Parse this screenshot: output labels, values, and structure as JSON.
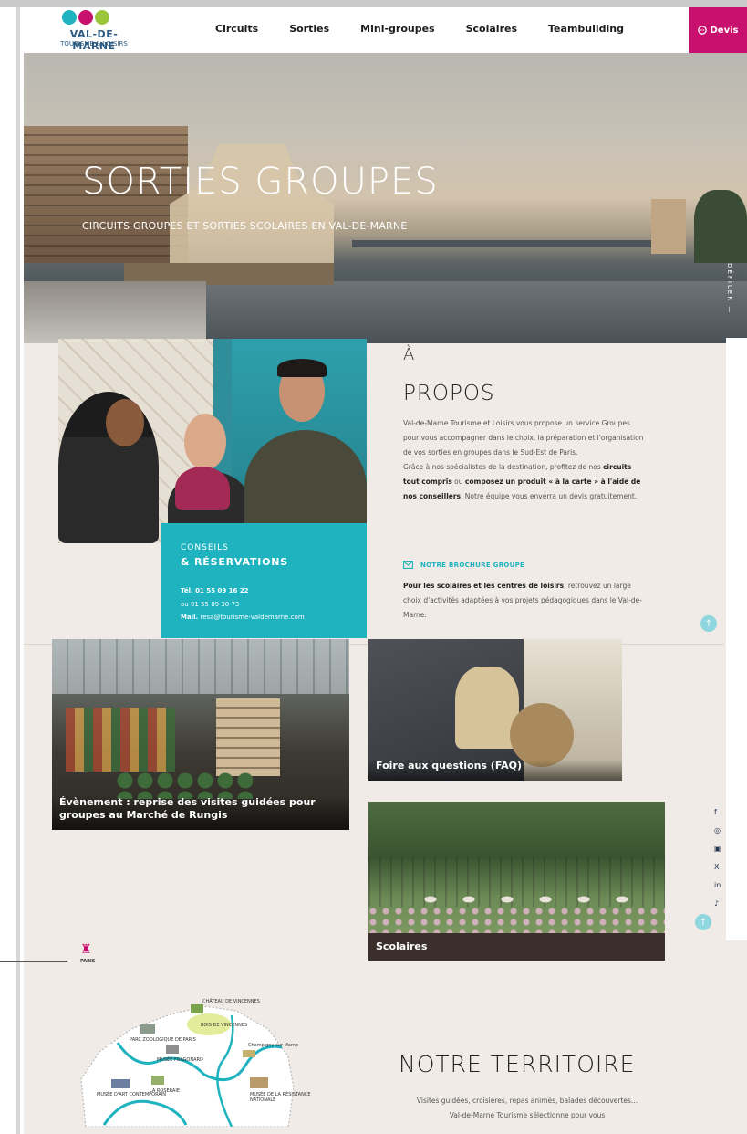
{
  "logo": {
    "line1": "VAL-DE-MARNE",
    "line2": "TOURISME & LOISIRS",
    "dot_colors": [
      "#1fb3c0",
      "#c8106e",
      "#9bc53d"
    ]
  },
  "nav": {
    "items": [
      "Circuits",
      "Sorties",
      "Mini-groupes",
      "Scolaires",
      "Teambuilding"
    ],
    "devis_label": "Devis"
  },
  "hero": {
    "title": "SORTIES GROUPES",
    "subtitle": "CIRCUITS GROUPES ET SORTIES SCOLAIRES EN VAL-DE-MARNE",
    "scroll_label": "DÉFILER —"
  },
  "about": {
    "title_top": "À",
    "title_main": "PROPOS",
    "paragraph_start": "Val-de-Marne Tourisme et Loisirs vous propose un service Groupes pour vous accompagner dans le choix, la préparation et l'organisation de vos sorties en groupes dans le Sud-Est de Paris.",
    "paragraph_2a": "Grâce à nos spécialistes de la destination, profitez de nos ",
    "bold_circuits": "circuits tout compris",
    "paragraph_2b": " ou ",
    "bold_compose": "composez un produit « à la carte » à l'aide de nos conseillers",
    "paragraph_2c": ". Notre équipe vous enverra un devis gratuitement.",
    "brochure_label": "NOTRE BROCHURE GROUPE",
    "bold_scolaires": "Pour les scolaires et les centres de loisirs",
    "paragraph_3": ", retrouvez un large choix d'activités adaptées à vos projets pédagogiques dans le Val-de-Marne."
  },
  "contact": {
    "line1": "CONSEILS",
    "line2": "& RÉSERVATIONS",
    "tel": "Tél. 01 55 09 16 22",
    "tel2": "ou 01 55 09 30 73",
    "mail_label": "Mail.",
    "mail": "resa@tourisme-valdemarne.com"
  },
  "cards": {
    "rungis": "Évènement : reprise des visites guidées pour groupes au Marché de Rungis",
    "faq": "Foire aux questions (FAQ)",
    "scolaires": "Scolaires"
  },
  "territory": {
    "title": "NOTRE TERRITOIRE",
    "text": "Visites guidées, croisières, repas animés, balades découvertes... Val-de-Marne Tourisme sélectionne pour vous",
    "paris_label": "PARIS",
    "map_labels": [
      "CHÂTEAU DE VINCENNES",
      "BOIS DE VINCENNES",
      "PARC ZOOLOGIQUE DE PARIS",
      "MUSÉE FRAGONARD",
      "MUSÉE D'ART CONTEMPORAIN",
      "LA ROSERAIE",
      "MUSÉE DE LA RÉSISTANCE NATIONALE",
      "Champigny-sur-Marne"
    ]
  },
  "edge": {
    "up_arrow": "↑",
    "social": [
      "f",
      "◎",
      "▣",
      "X",
      "in",
      "♪"
    ]
  }
}
